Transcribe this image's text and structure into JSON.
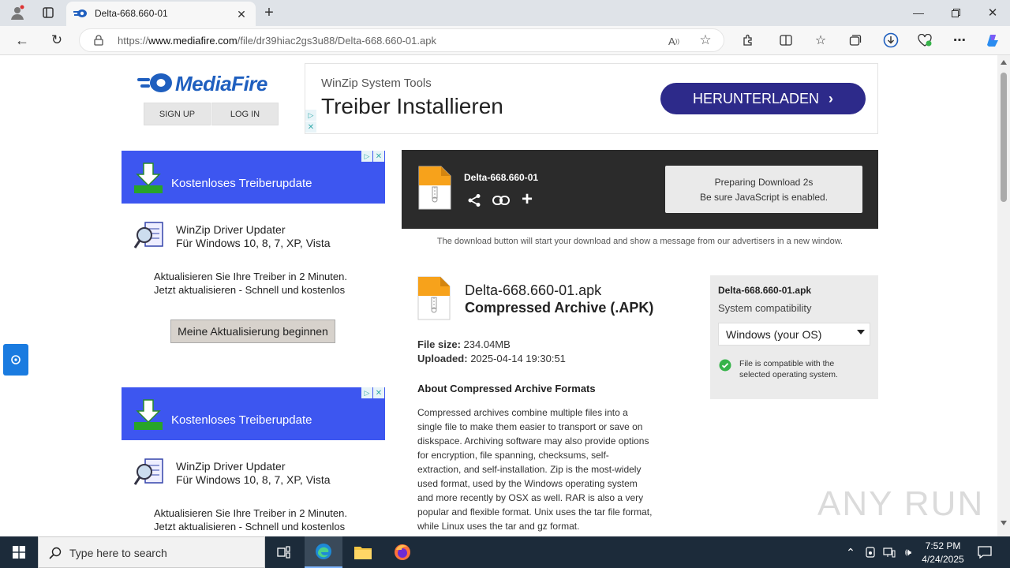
{
  "browser": {
    "tab_title": "Delta-668.660-01",
    "url_prefix": "https://",
    "url_host": "www.mediafire.com",
    "url_path": "/file/dr39hiac2gs3u88/Delta-668.660-01.apk"
  },
  "header": {
    "logo_text": "MediaFire",
    "signup": "SIGN UP",
    "login": "LOG IN"
  },
  "top_ad": {
    "brand": "WinZip System Tools",
    "headline": "Treiber Installieren",
    "button": "HERUNTERLADEN"
  },
  "side_ads": [
    {
      "header": "Kostenloses Treiberupdate",
      "product": "WinZip Driver Updater",
      "platforms": "Für Windows 10, 8, 7, XP, Vista",
      "line1": "Aktualisieren Sie Ihre Treiber in 2 Minuten.",
      "line2": "Jetzt aktualisieren - Schnell und kostenlos",
      "button": "Meine Aktualisierung beginnen"
    },
    {
      "header": "Kostenloses Treiberupdate",
      "product": "WinZip Driver Updater",
      "platforms": "Für Windows 10, 8, 7, XP, Vista",
      "line1": "Aktualisieren Sie Ihre Treiber in 2 Minuten.",
      "line2": "Jetzt aktualisieren - Schnell und kostenlos"
    }
  ],
  "download": {
    "file_name": "Delta-668.660-01",
    "preparing": "Preparing Download 2s",
    "js_note": "Be sure JavaScript is enabled.",
    "notice": "The download button will start your download and show a message from our advertisers in a new window."
  },
  "file_info": {
    "full_name": "Delta-668.660-01.apk",
    "type": "Compressed Archive (.APK)",
    "size_label": "File size:",
    "size_value": "234.04MB",
    "uploaded_label": "Uploaded:",
    "uploaded_value": "2025-04-14 19:30:51",
    "about_title": "About Compressed Archive Formats",
    "about_lines": [
      "Compressed archives combine multiple files into a",
      "single file to make them easier to transport or save on",
      "diskspace. Archiving software may also provide options",
      "for encryption, file spanning, checksums, self-",
      "extraction, and self-installation. Zip is the most-widely",
      "used format, used by the Windows operating system",
      "and more recently by OSX as well. RAR is also a very",
      "popular and flexible format. Unix uses the tar file format,",
      "while Linux uses the tar and gz format."
    ]
  },
  "compat": {
    "file_name": "Delta-668.660-01.apk",
    "label": "System compatibility",
    "selected_os": "Windows (your OS)",
    "status_line1": "File is compatible with the",
    "status_line2": "selected operating system."
  },
  "watermark": "ANY RUN",
  "taskbar": {
    "search_placeholder": "Type here to search",
    "time": "7:52 PM",
    "date": "4/24/2025"
  },
  "colors": {
    "mediafire_blue": "#1f5fbf",
    "ad_header_blue": "#3d56f0",
    "ad_button_purple": "#2d2a8a",
    "download_panel_dark": "#2b2b2b",
    "file_icon_orange": "#f7a21b",
    "compat_green": "#36b34a"
  }
}
